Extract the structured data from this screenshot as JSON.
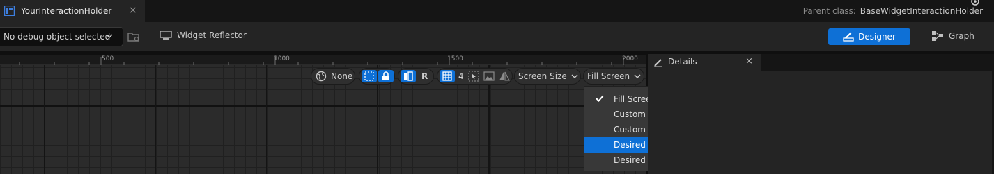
{
  "tab": {
    "title": "YourInteractionHolder",
    "close_glyph": "×"
  },
  "header": {
    "parent_class_label": "Parent class:",
    "parent_class_value": "BaseWidgetInteractionHolder"
  },
  "toolbar": {
    "debug_object": "No debug object selected",
    "widget_reflector": "Widget Reflector",
    "designer": "Designer",
    "graph": "Graph"
  },
  "ruler": {
    "labels": [
      "500",
      "1000",
      "1500",
      "2000"
    ]
  },
  "canvas_toolbar": {
    "localization": "None",
    "respect_locks_label": "R",
    "grid_snap_value": "4",
    "screen_size": "Screen Size",
    "fill_mode": "Fill Screen"
  },
  "fill_dropdown": {
    "items": [
      "Fill Screen",
      "Custom",
      "Custom on Screen",
      "Desired",
      "Desired on Screen"
    ],
    "checked": "Fill Screen",
    "highlighted": "Desired"
  },
  "details": {
    "title": "Details",
    "close_glyph": "×"
  },
  "colors": {
    "accent": "#0e70d6",
    "background": "#0f0f0f",
    "panel": "#242424"
  }
}
